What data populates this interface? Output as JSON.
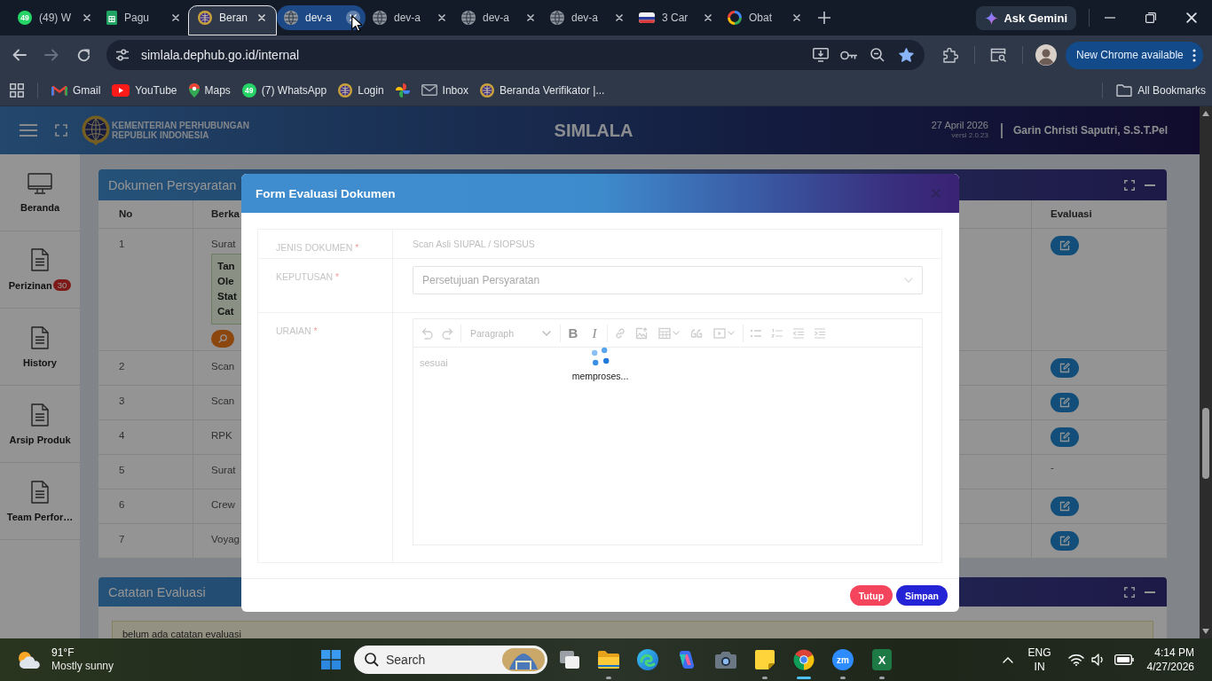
{
  "browser": {
    "tabs": [
      {
        "title": "(49) W",
        "kind": "chat",
        "badge": "49",
        "selected": false,
        "highlighted": false
      },
      {
        "title": "Pagu",
        "kind": "sheet",
        "selected": false,
        "highlighted": false
      },
      {
        "title": "Beran",
        "kind": "emblem",
        "selected": true,
        "highlighted": false
      },
      {
        "title": "dev-a",
        "kind": "globe",
        "selected": false,
        "highlighted": true
      },
      {
        "title": "dev-a",
        "kind": "globe",
        "selected": false,
        "highlighted": false
      },
      {
        "title": "dev-a",
        "kind": "globe",
        "selected": false,
        "highlighted": false
      },
      {
        "title": "dev-a",
        "kind": "globe",
        "selected": false,
        "highlighted": false
      },
      {
        "title": "3 Car",
        "kind": "flag",
        "selected": false,
        "highlighted": false
      },
      {
        "title": "Obat",
        "kind": "ring",
        "selected": false,
        "highlighted": false
      }
    ],
    "gemini_button": "Ask Gemini",
    "can_go_forward": false,
    "address": "simlala.dephub.go.id/internal",
    "bookmarked": true,
    "update_button": "New Chrome available",
    "bookmarks": [
      {
        "label": "Gmail",
        "kind": "mail"
      },
      {
        "label": "YouTube",
        "kind": "play"
      },
      {
        "label": "Maps",
        "kind": "pin"
      },
      {
        "label": "(7) WhatsApp",
        "kind": "chat",
        "badge": "49"
      },
      {
        "label": "Login",
        "kind": "emblem"
      },
      {
        "kind": "pinwheel"
      },
      {
        "label": "Inbox",
        "kind": "envelope"
      },
      {
        "label": "Beranda Verifikator |...",
        "kind": "emblem"
      }
    ],
    "all_bookmarks": "All Bookmarks"
  },
  "app": {
    "header": {
      "org_line_1": "KEMENTERIAN PERHUBUNGAN",
      "org_line_2": "REPUBLIK INDONESIA",
      "title": "SIMLALA",
      "date": "27 April 2026",
      "version": "versi 2.0.23",
      "user": "Garin Christi Saputri, S.S.T.Pel"
    },
    "sidebar": [
      {
        "label": "Beranda",
        "kind": "monitor"
      },
      {
        "label": "Perizinan",
        "kind": "document",
        "badge": "30"
      },
      {
        "label": "History",
        "kind": "document"
      },
      {
        "label": "Arsip Produk",
        "kind": "document"
      },
      {
        "label": "Team Perfor…",
        "kind": "document"
      }
    ],
    "documents": {
      "title": "Dokumen Persyaratan",
      "columns": [
        "No",
        "Berka",
        "Evaluasi"
      ],
      "rows": [
        {
          "no": "1",
          "file": "Surat",
          "note_lines": [
            "Tan",
            "Ole",
            "Stat",
            "Cat"
          ],
          "view_button": true,
          "evaluation": {
            "kind": "edit"
          }
        },
        {
          "no": "2",
          "file": "Scan",
          "evaluation": {
            "kind": "edit"
          }
        },
        {
          "no": "3",
          "file": "Scan",
          "evaluation": {
            "kind": "edit"
          }
        },
        {
          "no": "4",
          "file": "RPK",
          "evaluation": {
            "kind": "edit"
          }
        },
        {
          "no": "5",
          "file": "Surat",
          "evaluation": {
            "kind": "text",
            "text": "-"
          }
        },
        {
          "no": "6",
          "file": "Crew",
          "evaluation": {
            "kind": "edit"
          }
        },
        {
          "no": "7",
          "file": "Voyag",
          "evaluation": {
            "kind": "edit"
          }
        }
      ]
    },
    "notes": {
      "title": "Catatan Evaluasi",
      "text": "belum ada catatan evaluasi"
    }
  },
  "modal": {
    "title": "Form Evaluasi Dokumen",
    "fields": [
      {
        "kind": "text",
        "label": "JENIS DOKUMEN",
        "required_mark": "*",
        "value": "Scan Asli SIUPAL / SIOPSUS"
      },
      {
        "kind": "select",
        "label": "KEPUTUSAN",
        "required_mark": "*",
        "value": "Persetujuan Persyaratan"
      },
      {
        "kind": "editor",
        "label": "URAIAN",
        "required_mark": "*",
        "toolbar": [
          [
            {
              "kind": "undo"
            },
            {
              "kind": "redo"
            }
          ],
          [
            {
              "kind": "heading",
              "label": "Paragraph"
            }
          ],
          [
            {
              "kind": "bold",
              "glyph": "B"
            },
            {
              "kind": "italic",
              "glyph": "I"
            }
          ],
          [
            {
              "kind": "link"
            },
            {
              "kind": "image"
            },
            {
              "kind": "table"
            },
            {
              "kind": "quote"
            },
            {
              "kind": "media"
            }
          ],
          [
            {
              "kind": "bullets"
            },
            {
              "kind": "numbers"
            },
            {
              "kind": "outdent"
            },
            {
              "kind": "indent"
            }
          ]
        ],
        "value": "sesuai"
      }
    ],
    "loading_text": "memproses...",
    "buttons": [
      {
        "label": "Tutup",
        "kind": "cancel"
      },
      {
        "label": "Simpan",
        "kind": "primary"
      }
    ]
  },
  "taskbar": {
    "weather": {
      "temperature": "91°F",
      "condition": "Mostly sunny"
    },
    "search_placeholder": "Search",
    "apps": [
      {
        "kind": "task-view",
        "running": false,
        "active": false
      },
      {
        "kind": "folder",
        "running": true,
        "active": false
      },
      {
        "kind": "swirl",
        "running": false,
        "active": false
      },
      {
        "kind": "ribbon",
        "running": false,
        "active": false
      },
      {
        "kind": "camera",
        "running": false,
        "active": false
      },
      {
        "kind": "note",
        "running": true,
        "active": false
      },
      {
        "kind": "browser",
        "running": true,
        "active": true
      },
      {
        "kind": "meeting",
        "glyph": "zm",
        "running": true,
        "active": false
      },
      {
        "kind": "spreadsheet",
        "glyph": "X",
        "running": true,
        "active": false
      }
    ],
    "tray": {
      "language": "ENG",
      "region": "IN",
      "time": "4:14 PM",
      "date": "4/27/2026"
    }
  }
}
